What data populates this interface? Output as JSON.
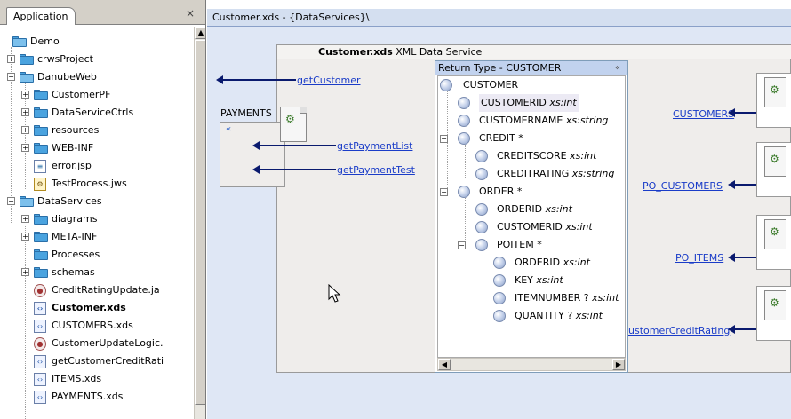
{
  "left_panel": {
    "tab_label": "Application",
    "close_glyph": "×",
    "scroll_up_glyph": "▲",
    "tree": [
      {
        "label": "Demo",
        "icon": "folder-open-icon"
      },
      {
        "label": "crwsProject",
        "icon": "project-icon"
      },
      {
        "label": "DanubeWeb",
        "icon": "folder-open-icon"
      },
      {
        "label": "CustomerPF",
        "icon": "folder-icon"
      },
      {
        "label": "DataServiceCtrls",
        "icon": "folder-icon"
      },
      {
        "label": "resources",
        "icon": "folder-icon"
      },
      {
        "label": "WEB-INF",
        "icon": "folder-icon"
      },
      {
        "label": "error.jsp",
        "icon": "jsp-file-icon"
      },
      {
        "label": "TestProcess.jws",
        "icon": "jws-file-icon"
      },
      {
        "label": "DataServices",
        "icon": "folder-open-icon"
      },
      {
        "label": "diagrams",
        "icon": "folder-icon"
      },
      {
        "label": "META-INF",
        "icon": "folder-icon"
      },
      {
        "label": "Processes",
        "icon": "folder-icon"
      },
      {
        "label": "schemas",
        "icon": "folder-icon"
      },
      {
        "label": "CreditRatingUpdate.ja",
        "icon": "java-file-icon"
      },
      {
        "label": "Customer.xds",
        "icon": "xds-file-icon"
      },
      {
        "label": "CUSTOMERS.xds",
        "icon": "xds-file-icon"
      },
      {
        "label": "CustomerUpdateLogic.",
        "icon": "java-file-icon"
      },
      {
        "label": "getCustomerCreditRati",
        "icon": "xds-file-icon"
      },
      {
        "label": "ITEMS.xds",
        "icon": "xds-file-icon"
      },
      {
        "label": "PAYMENTS.xds",
        "icon": "xds-file-icon"
      }
    ]
  },
  "editor": {
    "tab_title": "Customer.xds - {DataServices}\\",
    "design_title_bold": "Customer.xds",
    "design_title_rest": "XML Data Service",
    "return_type_title": "Return Type - CUSTOMER",
    "return_type_chevron": "«",
    "payments_label": "PAYMENTS",
    "payments_chevron": "«",
    "hscroll_left": "◀",
    "hscroll_right": "▶",
    "left_links": [
      "getCustomer",
      "getPaymentList",
      "getPaymentTest"
    ],
    "right_links": [
      "CUSTOMERS",
      "PO_CUSTOMERS",
      "PO_ITEMS",
      "ustomerCreditRating"
    ],
    "schema": [
      {
        "name": "CUSTOMER",
        "type": ""
      },
      {
        "name": "CUSTOMERID",
        "type": "xs:int"
      },
      {
        "name": "CUSTOMERNAME",
        "type": "xs:string"
      },
      {
        "name": "CREDIT *",
        "type": ""
      },
      {
        "name": "CREDITSCORE",
        "type": "xs:int"
      },
      {
        "name": "CREDITRATING",
        "type": "xs:string"
      },
      {
        "name": "ORDER *",
        "type": ""
      },
      {
        "name": "ORDERID",
        "type": "xs:int"
      },
      {
        "name": "CUSTOMERID",
        "type": "xs:int"
      },
      {
        "name": "POITEM *",
        "type": ""
      },
      {
        "name": "ORDERID",
        "type": "xs:int"
      },
      {
        "name": "KEY",
        "type": "xs:int"
      },
      {
        "name": "ITEMNUMBER ?",
        "type": "xs:int"
      },
      {
        "name": "QUANTITY ?",
        "type": "xs:int"
      }
    ]
  }
}
